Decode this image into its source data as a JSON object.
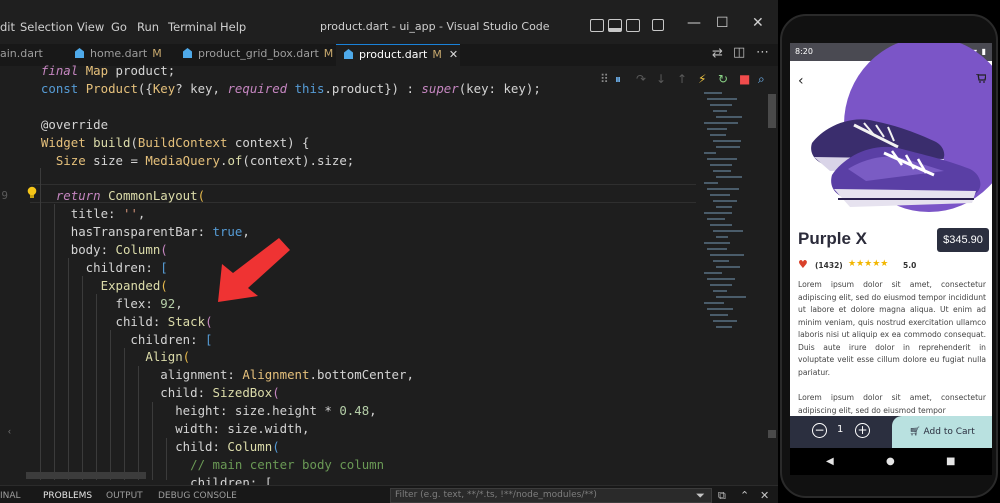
{
  "titlebar": {
    "menu": [
      "dit",
      "Selection",
      "View",
      "Go",
      "Run",
      "Terminal",
      "Help"
    ],
    "window_title": "product.dart - ui_app - Visual Studio Code",
    "minimize": "—",
    "maximize": "☐",
    "close": "✕"
  },
  "tabs": [
    {
      "label": "ain.dart",
      "modified": ""
    },
    {
      "label": "home.dart",
      "modified": "M"
    },
    {
      "label": "product_grid_box.dart",
      "modified": "M"
    },
    {
      "label": "product.dart",
      "modified": "M",
      "close": "✕"
    }
  ],
  "code": {
    "lines": [
      {
        "num": "",
        "segments": [
          [
            "gray",
            "  "
          ],
          [
            "kc",
            "final "
          ],
          [
            "t",
            "Map "
          ],
          [
            "gray",
            "product;"
          ]
        ]
      },
      {
        "num": "",
        "segments": [
          [
            "gray",
            "  "
          ],
          [
            "k",
            "const "
          ],
          [
            "t",
            "Product"
          ],
          [
            "gray",
            "({"
          ],
          [
            "t",
            "Key"
          ],
          [
            "gray",
            "? key, "
          ],
          [
            "kc",
            "required "
          ],
          [
            "k",
            "this"
          ],
          [
            "gray",
            ".product}) : "
          ],
          [
            "kc",
            "super"
          ],
          [
            "gray",
            "(key: key);"
          ]
        ]
      },
      {
        "num": "",
        "segments": [
          [
            "gray",
            ""
          ]
        ]
      },
      {
        "num": "",
        "segments": [
          [
            "gray",
            "  @override"
          ]
        ]
      },
      {
        "num": "",
        "segments": [
          [
            "gray",
            "  "
          ],
          [
            "t",
            "Widget "
          ],
          [
            "f",
            "build"
          ],
          [
            "gray",
            "("
          ],
          [
            "t",
            "BuildContext "
          ],
          [
            "gray",
            "context) {"
          ]
        ]
      },
      {
        "num": "",
        "segments": [
          [
            "gray",
            "    "
          ],
          [
            "t",
            "Size "
          ],
          [
            "gray",
            "size = "
          ],
          [
            "t",
            "MediaQuery"
          ],
          [
            "gray",
            "."
          ],
          [
            "f",
            "of"
          ],
          [
            "gray",
            "(context).size;"
          ]
        ]
      },
      {
        "num": "",
        "segments": [
          [
            "gray",
            ""
          ]
        ]
      },
      {
        "num": "9",
        "segments": [
          [
            "gray",
            "    "
          ],
          [
            "kc",
            "return "
          ],
          [
            "f",
            "CommonLayout"
          ],
          [
            "y",
            "("
          ]
        ]
      },
      {
        "num": "",
        "segments": [
          [
            "gray",
            "      title: "
          ],
          [
            "s",
            "''"
          ],
          [
            "gray",
            ","
          ]
        ]
      },
      {
        "num": "",
        "segments": [
          [
            "gray",
            "      hasTransparentBar: "
          ],
          [
            "k",
            "true"
          ],
          [
            "gray",
            ","
          ]
        ]
      },
      {
        "num": "",
        "segments": [
          [
            "gray",
            "      body: "
          ],
          [
            "f",
            "Column"
          ],
          [
            "kw2",
            "("
          ]
        ]
      },
      {
        "num": "",
        "segments": [
          [
            "gray",
            "        children: "
          ],
          [
            "k",
            "["
          ]
        ]
      },
      {
        "num": "",
        "segments": [
          [
            "gray",
            "          "
          ],
          [
            "f",
            "Expanded"
          ],
          [
            "y",
            "("
          ]
        ]
      },
      {
        "num": "",
        "segments": [
          [
            "gray",
            "            flex: "
          ],
          [
            "n",
            "92"
          ],
          [
            "gray",
            ","
          ]
        ]
      },
      {
        "num": "",
        "segments": [
          [
            "gray",
            "            child: "
          ],
          [
            "f",
            "Stack"
          ],
          [
            "kw2",
            "("
          ]
        ]
      },
      {
        "num": "",
        "segments": [
          [
            "gray",
            "              children: "
          ],
          [
            "k",
            "["
          ]
        ]
      },
      {
        "num": "",
        "segments": [
          [
            "gray",
            "                "
          ],
          [
            "f",
            "Align"
          ],
          [
            "y",
            "("
          ]
        ]
      },
      {
        "num": "",
        "segments": [
          [
            "gray",
            "                  alignment: "
          ],
          [
            "t",
            "Alignment"
          ],
          [
            "gray",
            ".bottomCenter,"
          ]
        ]
      },
      {
        "num": "",
        "segments": [
          [
            "gray",
            "                  child: "
          ],
          [
            "f",
            "SizedBox"
          ],
          [
            "kw2",
            "("
          ]
        ]
      },
      {
        "num": "",
        "segments": [
          [
            "gray",
            "                    height: size.height * "
          ],
          [
            "n",
            "0.48"
          ],
          [
            "gray",
            ","
          ]
        ]
      },
      {
        "num": "",
        "segments": [
          [
            "gray",
            "                    width: size.width,"
          ]
        ]
      },
      {
        "num": "",
        "segments": [
          [
            "gray",
            "                    child: "
          ],
          [
            "f",
            "Column"
          ],
          [
            "k",
            "("
          ]
        ]
      },
      {
        "num": "",
        "segments": [
          [
            "gray",
            "                      "
          ],
          [
            "cm",
            "// main center body column"
          ]
        ]
      },
      {
        "num": "",
        "segments": [
          [
            "gray",
            "                      children: ["
          ]
        ]
      }
    ]
  },
  "panel": {
    "tabs": [
      "INAL",
      "PROBLEMS",
      "OUTPUT",
      "DEBUG CONSOLE"
    ],
    "filter_placeholder": "Filter (e.g. text, **/*.ts, !**/node_modules/**)"
  },
  "phone": {
    "status_time": "8:20",
    "status_right": "⊖ ▾ ▮",
    "product_name": "Purple X",
    "price": "$345.90",
    "reviews": "(1432)",
    "stars": "★★★★★",
    "rating": "5.0",
    "description_1": "Lorem ipsum dolor sit amet, consectetur adipiscing elit, sed do eiusmod tempor incididunt ut labore et dolore magna aliqua. Ut enim ad minim veniam, quis nostrud exercitation ullamco laboris nisi ut aliquip ex ea commodo consequat. Duis aute irure dolor in reprehenderit in voluptate velit esse cillum dolore eu fugiat nulla pariatur.",
    "description_2": "Lorem ipsum dolor sit amet, consectetur adipiscing elit, sed do eiusmod tempor",
    "quantity": "1",
    "add_to_cart": "Add to Cart",
    "colors": {
      "accent": "#7b55c7",
      "dark": "#2b2f3f",
      "cart_button": "#b9e1e0"
    }
  }
}
